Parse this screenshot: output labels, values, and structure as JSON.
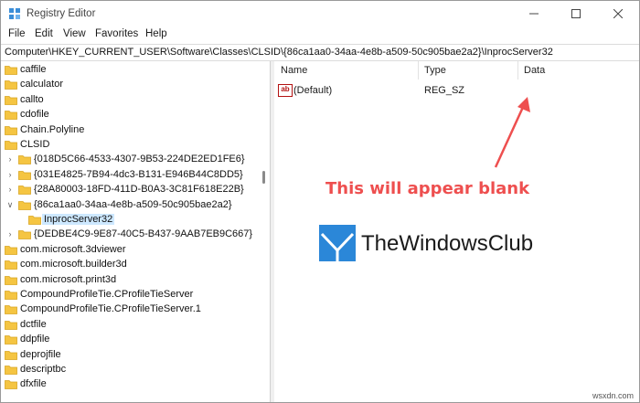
{
  "window": {
    "title": "Registry Editor",
    "controls": [
      "minimize-icon",
      "maximize-icon",
      "close-icon"
    ]
  },
  "menu": [
    "File",
    "Edit",
    "View",
    "Favorites",
    "Help"
  ],
  "address": "Computer\\HKEY_CURRENT_USER\\Software\\Classes\\CLSID\\{86ca1aa0-34aa-4e8b-a509-50c905bae2a2}\\InprocServer32",
  "tree": [
    {
      "label": "caffile",
      "level": 0,
      "expander": "none"
    },
    {
      "label": "calculator",
      "level": 0,
      "expander": "none"
    },
    {
      "label": "callto",
      "level": 0,
      "expander": "none"
    },
    {
      "label": "cdofile",
      "level": 0,
      "expander": "none"
    },
    {
      "label": "Chain.Polyline",
      "level": 0,
      "expander": "none"
    },
    {
      "label": "CLSID",
      "level": 0,
      "expander": "none"
    },
    {
      "label": "{018D5C66-4533-4307-9B53-224DE2ED1FE6}",
      "level": 1,
      "expander": "collapsed"
    },
    {
      "label": "{031E4825-7B94-4dc3-B131-E946B44C8DD5}",
      "level": 1,
      "expander": "collapsed"
    },
    {
      "label": "{28A80003-18FD-411D-B0A3-3C81F618E22B}",
      "level": 1,
      "expander": "collapsed"
    },
    {
      "label": "{86ca1aa0-34aa-4e8b-a509-50c905bae2a2}",
      "level": 1,
      "expander": "expanded"
    },
    {
      "label": "InprocServer32",
      "level": 2,
      "expander": "none",
      "selected": true
    },
    {
      "label": "{DEDBE4C9-9E87-40C5-B437-9AAB7EB9C667}",
      "level": 1,
      "expander": "collapsed"
    },
    {
      "label": "com.microsoft.3dviewer",
      "level": 0,
      "expander": "none"
    },
    {
      "label": "com.microsoft.builder3d",
      "level": 0,
      "expander": "none"
    },
    {
      "label": "com.microsoft.print3d",
      "level": 0,
      "expander": "none"
    },
    {
      "label": "CompoundProfileTie.CProfileTieServer",
      "level": 0,
      "expander": "none"
    },
    {
      "label": "CompoundProfileTie.CProfileTieServer.1",
      "level": 0,
      "expander": "none"
    },
    {
      "label": "dctfile",
      "level": 0,
      "expander": "none"
    },
    {
      "label": "ddpfile",
      "level": 0,
      "expander": "none"
    },
    {
      "label": "deprojfile",
      "level": 0,
      "expander": "none"
    },
    {
      "label": "descriptbc",
      "level": 0,
      "expander": "none"
    },
    {
      "label": "dfxfile",
      "level": 0,
      "expander": "none"
    }
  ],
  "columns": {
    "name": "Name",
    "type": "Type",
    "data": "Data"
  },
  "values": [
    {
      "icon": "ab",
      "name": "(Default)",
      "type": "REG_SZ",
      "data": ""
    }
  ],
  "annotation": "This will appear blank",
  "logo_text": "TheWindowsClub",
  "watermark": "wsxdn.com",
  "colors": {
    "folder": "#f5c542",
    "selection": "#cde8ff",
    "annotation": "#ee4f4f",
    "logo_blue": "#2b87d8"
  }
}
